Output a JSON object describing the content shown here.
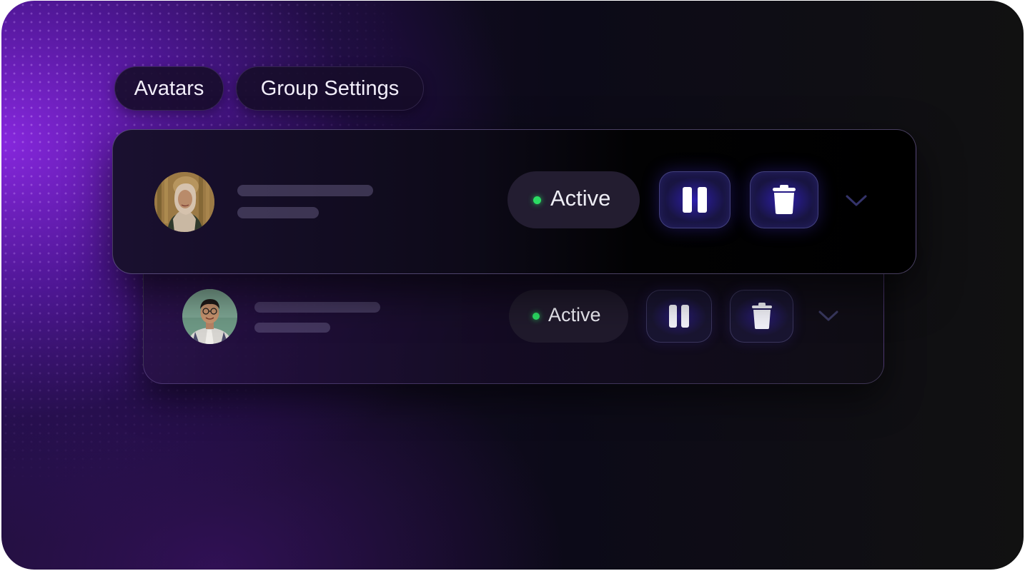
{
  "tabs": [
    {
      "label": "Avatars"
    },
    {
      "label": "Group Settings"
    }
  ],
  "rows": [
    {
      "avatar": "avatar-photo-woman-hijab",
      "status": {
        "label": "Active",
        "color": "#2bdd63"
      },
      "actions": {
        "pause_icon": "pause-icon",
        "delete_icon": "trash-icon",
        "expand_icon": "chevron-down-icon"
      }
    },
    {
      "avatar": "avatar-photo-man-glasses",
      "status": {
        "label": "Active",
        "color": "#2bdd63"
      },
      "actions": {
        "pause_icon": "pause-icon",
        "delete_icon": "trash-icon",
        "expand_icon": "chevron-down-icon"
      }
    }
  ],
  "colors": {
    "accent_purple": "#8c28e6",
    "status_active": "#2bdd63",
    "button_glow": "#3c28e6"
  }
}
